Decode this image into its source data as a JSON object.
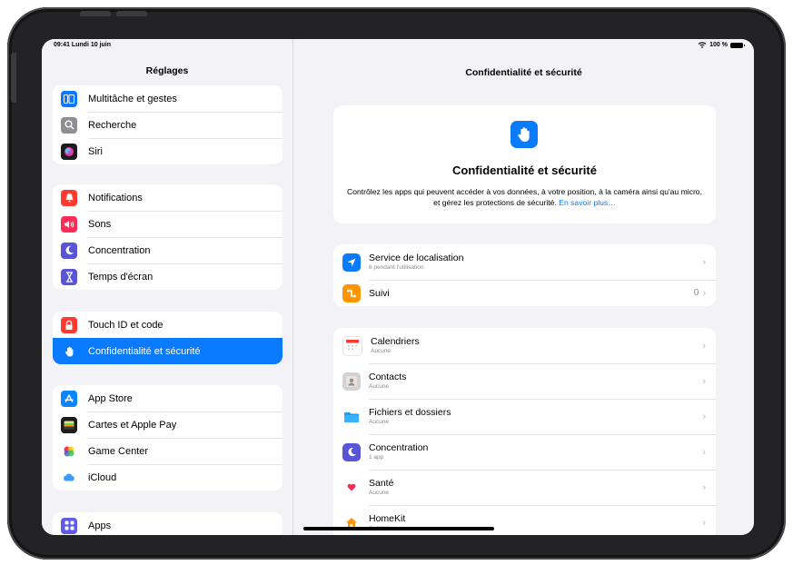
{
  "status_bar": {
    "time_date": "09:41  Lundi 10 juin",
    "battery": "100 %"
  },
  "sidebar": {
    "title": "Réglages",
    "groups": [
      {
        "items": [
          {
            "label": "Multitâche et gestes",
            "icon": "multitasking-icon",
            "color": "#0a7aff"
          },
          {
            "label": "Recherche",
            "icon": "search-icon",
            "color": "#8e8e93"
          },
          {
            "label": "Siri",
            "icon": "siri-icon",
            "color": "#1c1c1e"
          }
        ]
      },
      {
        "items": [
          {
            "label": "Notifications",
            "icon": "bell-icon",
            "color": "#ff3b30"
          },
          {
            "label": "Sons",
            "icon": "speaker-icon",
            "color": "#ff2d55"
          },
          {
            "label": "Concentration",
            "icon": "moon-icon",
            "color": "#5856d6"
          },
          {
            "label": "Temps d'écran",
            "icon": "hourglass-icon",
            "color": "#5856d6"
          }
        ]
      },
      {
        "items": [
          {
            "label": "Touch ID et code",
            "icon": "lock-icon",
            "color": "#ff3b30"
          },
          {
            "label": "Confidentialité et sécurité",
            "icon": "hand-icon",
            "color": "#0a7aff",
            "selected": true
          }
        ]
      },
      {
        "items": [
          {
            "label": "App Store",
            "icon": "app-store-icon",
            "color": "#0a84ff"
          },
          {
            "label": "Cartes et Apple Pay",
            "icon": "wallet-icon",
            "color": "#1c1c1e"
          },
          {
            "label": "Game Center",
            "icon": "game-center-icon",
            "color": "#ffffff"
          },
          {
            "label": "iCloud",
            "icon": "cloud-icon",
            "color": "#ffffff"
          }
        ]
      },
      {
        "items": [
          {
            "label": "Apps",
            "icon": "apps-grid-icon",
            "color": "#5e5ce6"
          }
        ]
      }
    ]
  },
  "main": {
    "title": "Confidentialité et sécurité",
    "hero": {
      "title": "Confidentialité et sécurité",
      "description": "Contrôlez les apps qui peuvent accéder à vos données, à votre position, à la caméra ainsi qu'au micro, et gérez les protections de sécurité.",
      "link": "En savoir plus…"
    },
    "group1": [
      {
        "title": "Service de localisation",
        "subtitle": "6 pendant l'utilisation",
        "value": "",
        "icon": "location-arrow-icon",
        "color": "#0a7aff"
      },
      {
        "title": "Suivi",
        "subtitle": "",
        "value": "0",
        "icon": "tracking-icon",
        "color": "#ff9500"
      }
    ],
    "group2": [
      {
        "title": "Calendriers",
        "subtitle": "Aucune",
        "icon": "calendar-icon"
      },
      {
        "title": "Contacts",
        "subtitle": "Aucune",
        "icon": "contacts-icon"
      },
      {
        "title": "Fichiers et dossiers",
        "subtitle": "Aucune",
        "icon": "folder-icon"
      },
      {
        "title": "Concentration",
        "subtitle": "1 app",
        "icon": "moon-icon"
      },
      {
        "title": "Santé",
        "subtitle": "Aucune",
        "icon": "health-heart-icon"
      },
      {
        "title": "HomeKit",
        "subtitle": "Aucune",
        "icon": "home-icon"
      }
    ]
  },
  "chevron": "›"
}
